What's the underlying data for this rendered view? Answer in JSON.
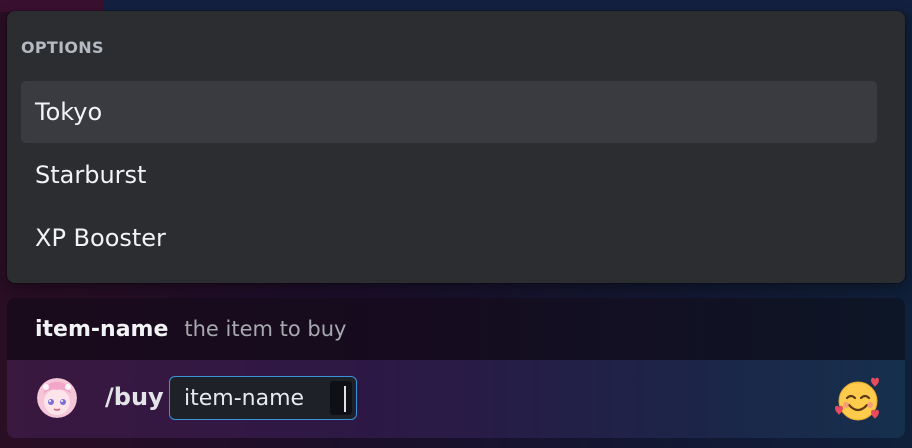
{
  "options_panel": {
    "header": "OPTIONS",
    "items": [
      {
        "label": "Tokyo",
        "selected": true
      },
      {
        "label": "Starburst",
        "selected": false
      },
      {
        "label": "XP Booster",
        "selected": false
      }
    ]
  },
  "param_hint": {
    "name": "item-name",
    "description": "the item to buy"
  },
  "composer": {
    "command": "/buy",
    "param_label": "item-name",
    "param_value": "",
    "avatar_icon": "user-avatar",
    "emoji_icon": "smiling-face-with-hearts-icon"
  },
  "colors": {
    "panel_bg": "#2b2d31",
    "selected_bg": "#393b41",
    "focus_border": "#3a93d8"
  }
}
